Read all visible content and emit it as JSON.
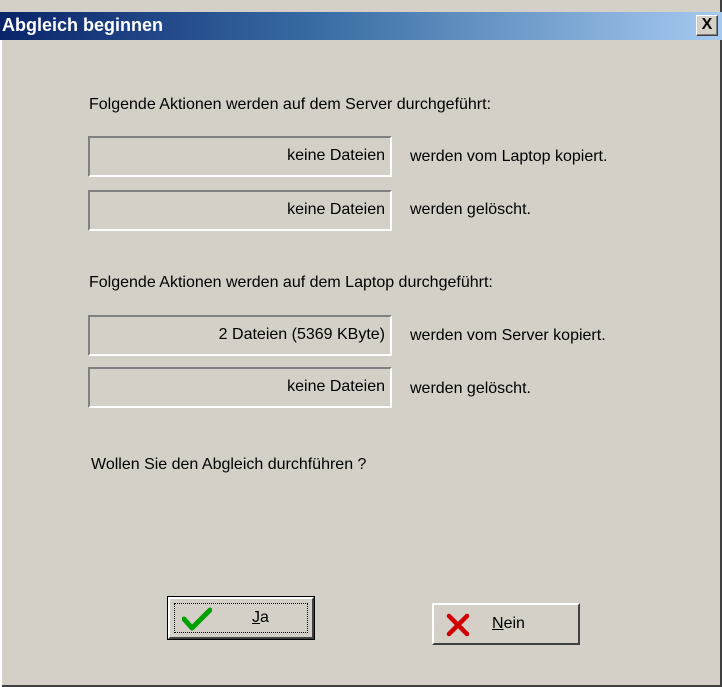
{
  "window": {
    "title": "Abgleich beginnen",
    "close_label": "X"
  },
  "server": {
    "heading": "Folgende Aktionen werden auf dem Server durchgeführt:",
    "copy_value": "keine Dateien",
    "copy_label": "werden vom Laptop kopiert.",
    "delete_value": "keine Dateien",
    "delete_label": "werden gelöscht."
  },
  "laptop": {
    "heading": "Folgende Aktionen werden auf dem Laptop durchgeführt:",
    "copy_value": "2 Dateien (5369  KByte)",
    "copy_label": "werden vom Server kopiert.",
    "delete_value": "keine Dateien",
    "delete_label": "werden gelöscht."
  },
  "question": "Wollen Sie den Abgleich durchführen ?",
  "buttons": {
    "yes_accel": "J",
    "yes_rest": "a",
    "no_accel": "N",
    "no_rest": "ein"
  },
  "colors": {
    "title_gradient_start": "#0a246a",
    "title_gradient_end": "#a6caf0",
    "check_green": "#00a000",
    "cross_red": "#d00000"
  }
}
